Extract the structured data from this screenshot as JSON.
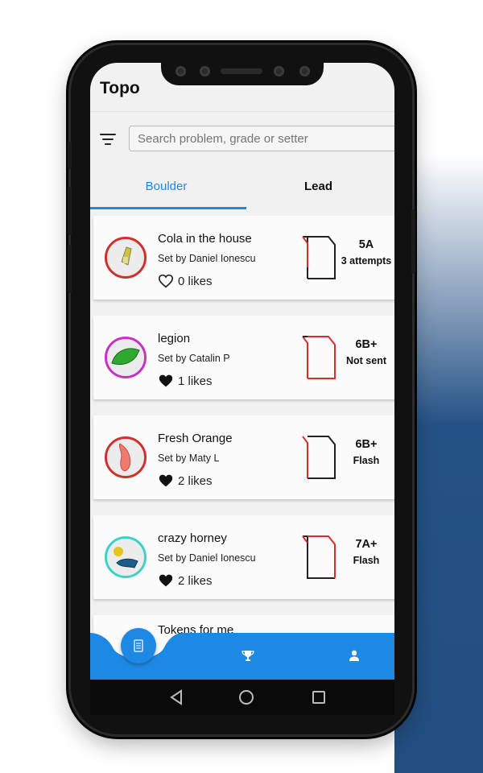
{
  "app": {
    "title": "Topo"
  },
  "search": {
    "placeholder": "Search problem, grade or setter"
  },
  "tabs": [
    {
      "label": "Boulder",
      "active": true
    },
    {
      "label": "Lead",
      "active": false
    }
  ],
  "problems": [
    {
      "name": "Cola in the house",
      "setter": "Set by Daniel Ionescu",
      "likes": "0 likes",
      "liked": false,
      "grade": "5A",
      "status": "3 attempts",
      "ring_color": "#d32f2f",
      "hold_color": "#c9c24a"
    },
    {
      "name": "legion",
      "setter": "Set by Catalin P",
      "likes": "1 likes",
      "liked": true,
      "grade": "6B+",
      "status": "Not sent",
      "ring_color": "#c532c5",
      "hold_color": "#2ea82e"
    },
    {
      "name": "Fresh Orange",
      "setter": "Set by Maty L",
      "likes": "2 likes",
      "liked": true,
      "grade": "6B+",
      "status": "Flash",
      "ring_color": "#d32f2f",
      "hold_color": "#f07a6e"
    },
    {
      "name": "crazy horney",
      "setter": "Set by Daniel Ionescu",
      "likes": "2 likes",
      "liked": true,
      "grade": "7A+",
      "status": "Flash",
      "ring_color": "#3fd1c9",
      "hold_color": "#e7c417"
    }
  ],
  "partial_item": {
    "name": "Tokens for me"
  },
  "bottom_nav": {
    "items": [
      "topo-icon",
      "trophy-icon",
      "person-icon"
    ],
    "accent": "#1e88e5"
  },
  "colors": {
    "accent": "#1e88e5",
    "status_red": "#d32f2f"
  }
}
